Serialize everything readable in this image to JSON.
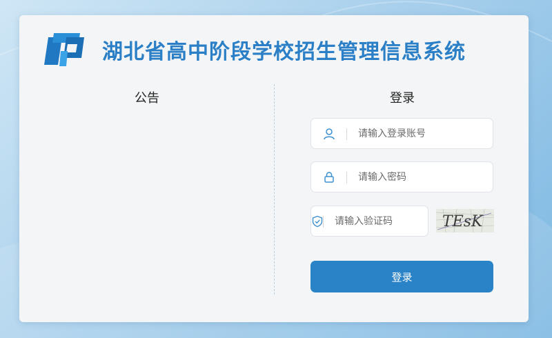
{
  "header": {
    "title": "湖北省高中阶段学校招生管理信息系统",
    "logo_icon": "system-logo-icon"
  },
  "notice": {
    "title": "公告"
  },
  "login": {
    "title": "登录",
    "username": {
      "placeholder": "请输入登录账号",
      "value": "",
      "icon": "user-icon"
    },
    "password": {
      "placeholder": "请输入密码",
      "value": "",
      "icon": "lock-icon"
    },
    "captcha": {
      "placeholder": "请输入验证码",
      "value": "",
      "icon": "shield-check-icon",
      "image_text": "TEsK"
    },
    "submit_label": "登录"
  },
  "colors": {
    "brand": "#2a7fc6",
    "button": "#2a83c7",
    "card": "#f4f5f6"
  }
}
